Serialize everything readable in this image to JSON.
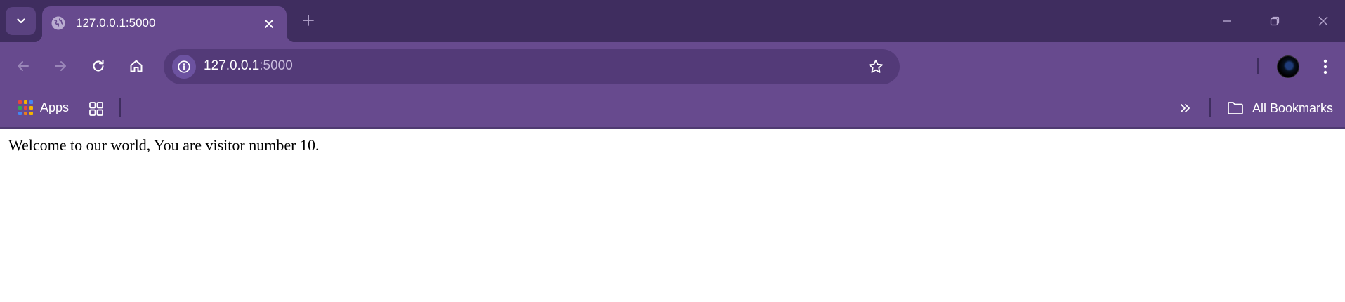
{
  "tab": {
    "title": "127.0.0.1:5000",
    "favicon": "globe-icon"
  },
  "omnibox": {
    "url_host": "127.0.0.1",
    "url_port": ":5000"
  },
  "bookmarks_bar": {
    "apps_label": "Apps",
    "all_bookmarks_label": "All Bookmarks"
  },
  "page": {
    "message": "Welcome to our world, You are visitor number 10."
  },
  "icons": {
    "tab_search": "chevron-down-icon",
    "tab_close": "close-icon",
    "new_tab": "plus-icon",
    "minimize": "minimize-icon",
    "restore": "restore-icon",
    "close_window": "close-icon",
    "back": "arrow-left-icon",
    "forward": "arrow-right-icon",
    "reload": "reload-icon",
    "home": "home-icon",
    "site_info": "info-icon",
    "bookmark_star": "star-icon",
    "profile": "avatar",
    "menu": "kebab-menu-icon",
    "apps": "apps-grid-icon",
    "tab_groups": "tab-groups-icon",
    "bookmarks_overflow": "double-chevron-right-icon",
    "folder": "folder-icon"
  },
  "colors": {
    "tabstrip_bg": "#3f2d5f",
    "toolbar_bg": "#674a8e",
    "omnibox_bg": "#533a78",
    "page_bg": "#ffffff",
    "text_light": "#ffffff"
  }
}
